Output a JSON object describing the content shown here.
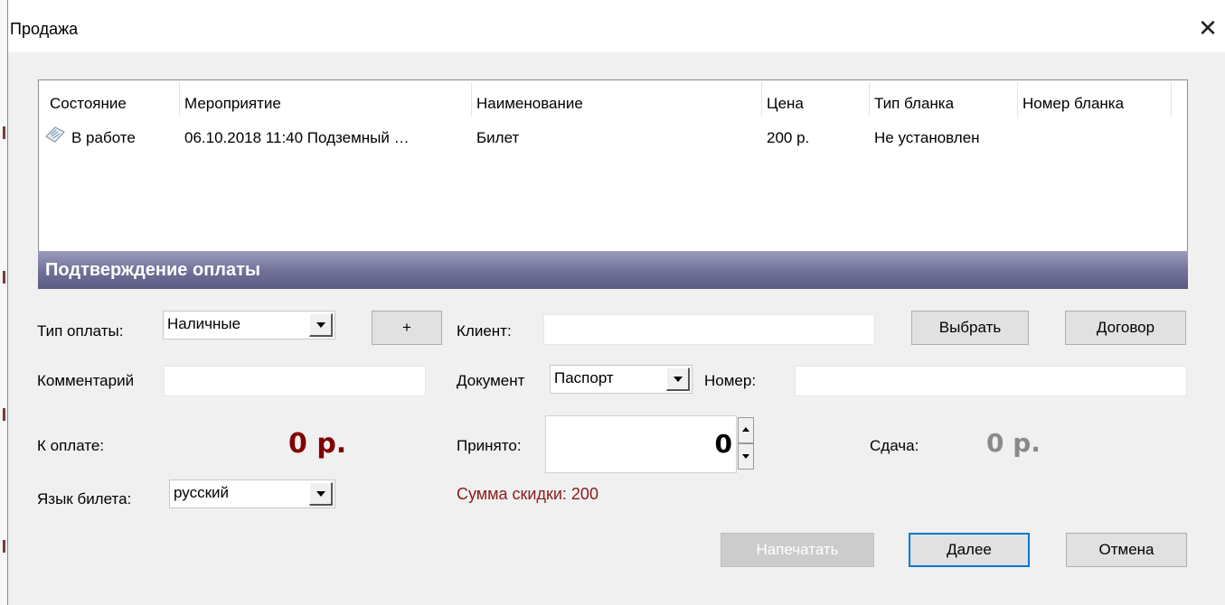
{
  "window": {
    "title": "Продажа",
    "close_glyph": "✕"
  },
  "grid": {
    "columns": [
      "Состояние",
      "Мероприятие",
      "Наименование",
      "Цена",
      "Тип бланка",
      "Номер бланка"
    ],
    "rows": [
      {
        "status_icon": "document-icon",
        "status": "В работе",
        "event": "06.10.2018 11:40 Подземный …",
        "name": "Билет",
        "price": "200 р.",
        "blank_type": "Не установлен",
        "blank_number": ""
      }
    ]
  },
  "payment_section": {
    "title": "Подтверждение оплаты"
  },
  "form": {
    "payment_type_label": "Тип оплаты:",
    "payment_type_value": "Наличные",
    "add_button": "+",
    "client_label": "Клиент:",
    "client_value": "",
    "select_button": "Выбрать",
    "contract_button": "Договор",
    "comment_label": "Комментарий",
    "comment_value": "",
    "document_label": "Документ",
    "document_value": "Паспорт",
    "number_label": "Номер:",
    "number_value": "",
    "to_pay_label": "К оплате:",
    "to_pay_value": "0 р.",
    "received_label": "Принято:",
    "received_value": "0",
    "change_label": "Сдача:",
    "change_value": "0 р.",
    "discount_text": "Сумма скидки:  200",
    "ticket_lang_label": "Язык билета:",
    "ticket_lang_value": "русский"
  },
  "buttons": {
    "print": "Напечатать",
    "next": "Далее",
    "cancel": "Отмена"
  },
  "colors": {
    "accent": "#0078d7",
    "amount_due": "#800000",
    "discount": "#8b1a1a",
    "band": "#6f6f97"
  }
}
